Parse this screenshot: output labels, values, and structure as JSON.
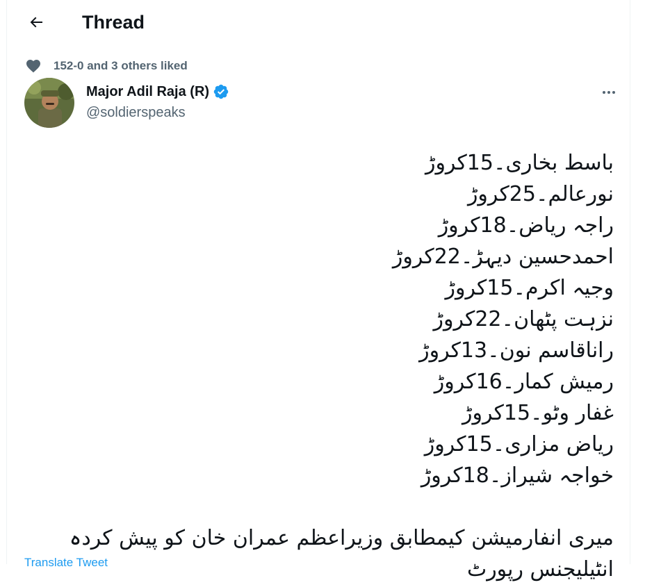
{
  "header": {
    "back_icon": "arrow-left-icon",
    "title": "Thread"
  },
  "social_context": {
    "icon": "heart-icon",
    "text": "152-0 and 3 others liked"
  },
  "author": {
    "name": "Major Adil Raja (R)",
    "handle": "@soldierspeaks",
    "verified_icon": "verified-badge-icon",
    "more_icon": "more-dots-icon"
  },
  "tweet": {
    "lines": [
      "باسط بخاری۔15کروڑ",
      "نورعالم۔25کروڑ",
      "راجہ ریاض۔18کروڑ",
      "احمدحسین دیہڑ۔22کروڑ",
      "وجیہ اکرم۔15کروڑ",
      "نزہت پٹھان۔22کروڑ",
      "راناقاسم نون۔13کروڑ",
      "رمیش کمار۔16کروڑ",
      "غفار وٹو۔15کروڑ",
      "ریاض مزاری۔15کروڑ",
      "خواجہ شیراز۔18کروڑ"
    ],
    "paragraph": "میری انفارمیشن کیمطابق وزیراعظم عمران خان کو پیش کردہ انٹیلیجنس رپورٹ"
  },
  "translate_link": "Translate Tweet",
  "colors": {
    "text_primary": "#0f1419",
    "text_secondary": "#536471",
    "accent": "#1d9bf0"
  }
}
